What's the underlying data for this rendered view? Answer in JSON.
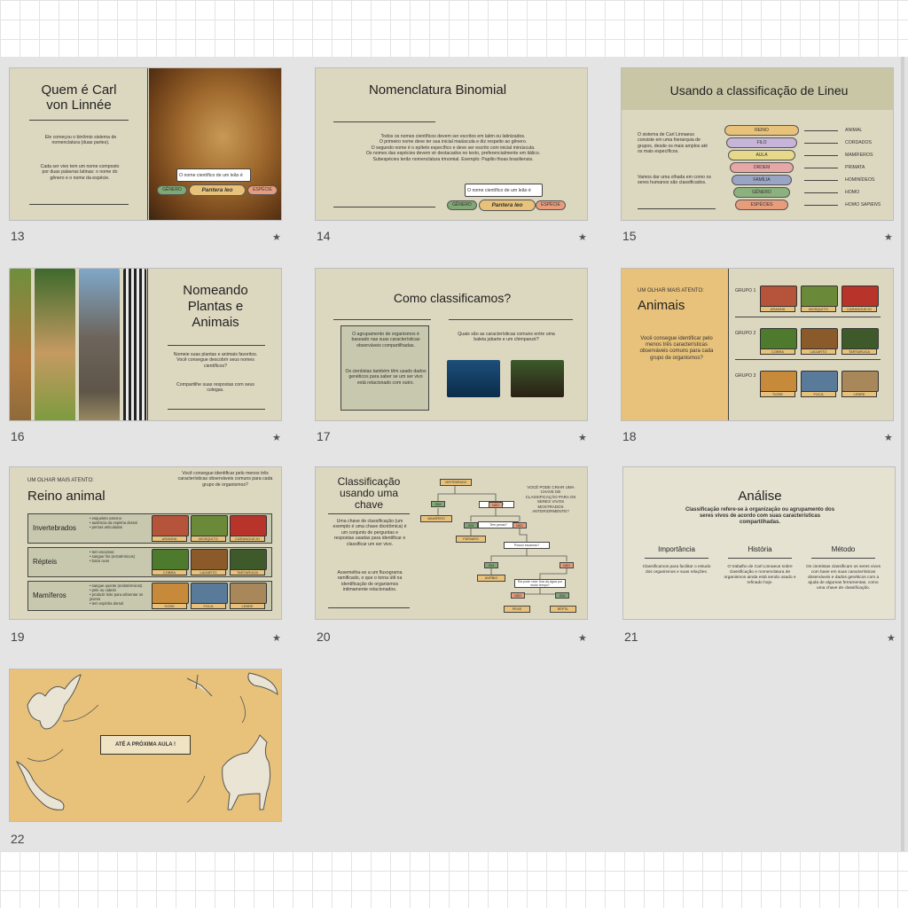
{
  "slides": [
    {
      "number": "13",
      "title": "Quem é Carl von Linnée",
      "body": "Ele começou o binômio sistema de nomenclatura (duas partes).",
      "body2": "Cada ser vivo tem um nome composto por duas palavras latinas: o nome do gênero e o nome da espécie.",
      "callout": "O nome científico de um leão é",
      "genus": "GÊNERO",
      "species_name": "Pantera leo",
      "species": "ESPÉCIE"
    },
    {
      "number": "14",
      "title": "Nomenclatura Binomial",
      "bullets": [
        "Todos os nomes científicos devem ser escritos em latim ou latinizados.",
        "O primeiro nome deve ter sua inicial maiúscula e diz respeito ao gênero.",
        "O segundo nome é o epíteto específico e deve ser escrito com inicial minúscula.",
        "Os nomes das espécies devem vir destacados no texto, preferencialmente em itálico.",
        "Subespécies terão nomenclatura trinomial. Exemplo: Papilio thoas brasiliensis."
      ],
      "callout": "O nome científico de um leão é",
      "genus": "GÊNERO",
      "species_name": "Pantera leo",
      "species": "ESPÉCIE"
    },
    {
      "number": "15",
      "title": "Usando a classificação de Lineu",
      "body": "O sistema de Carl Linnaeus consiste em uma hierarquia de grupos, desde os mais amplos até os mais específicos.",
      "body2": "Vamos dar uma olhada em como os seres humanos são classificados.",
      "ranks": [
        "REINO",
        "FILO",
        "AULA",
        "ORDEM",
        "FAMÍLIA",
        "GÊNERO",
        "ESPÉCIES"
      ],
      "values": [
        "ANIMAL",
        "CORDADOS",
        "MAMÍFEROS",
        "PRIMATA",
        "HOMINÍDEOS",
        "HOMO",
        "HOMO SAPIENS"
      ]
    },
    {
      "number": "16",
      "title": "Nomeando Plantas e Animais",
      "body": "Nomeie suas plantas e animais favoritos. Você consegue descobrir seus nomes científicos?",
      "body2": "Compartilhe suas respostas com seus colegas."
    },
    {
      "number": "17",
      "title": "Como classificamos?",
      "body": "O agrupamento de organismos é baseado nas suas características observáveis compartilhadas.",
      "body2": "Os cientistas também têm usado dados genéticos para saber se um ser vivo está relacionado com outro.",
      "question": "Quais são as características comuns entre uma baleia jubarte e um chimpanzé?"
    },
    {
      "number": "18",
      "kicker": "UM OLHAR MAIS ATENTO:",
      "title": "Animais",
      "body": "Você consegue identificar pelo menos três características observáveis comuns para cada grupo de organismos?",
      "groups": [
        {
          "label": "GRUPO 1",
          "items": [
            "ARANHA",
            "MOSQUITO",
            "CARANGUEJO"
          ]
        },
        {
          "label": "GRUPO 2",
          "items": [
            "COBRA",
            "LAGARTO",
            "TARTARUGA"
          ]
        },
        {
          "label": "GRUPO 3",
          "items": [
            "TIGRE",
            "FOCA",
            "LEBRE"
          ]
        }
      ]
    },
    {
      "number": "19",
      "kicker": "UM OLHAR MAIS ATENTO:",
      "title": "Reino animal",
      "question": "Você consegue identificar pelo menos três características observáveis comuns para cada grupo de organismos?",
      "rows": [
        {
          "label": "Invertebrados",
          "points": "• esqueleto externo\n• ausência da espinha dorsal\n• pernas articuladas",
          "items": [
            "ARANHA",
            "MOSQUITO",
            "CARANGUEJO"
          ]
        },
        {
          "label": "Répteis",
          "points": "• tem escamas\n• sangue frio (ectotérmicos)\n• botar ovos",
          "items": [
            "COBRA",
            "LAGARTO",
            "TARTARUGA"
          ]
        },
        {
          "label": "Mamíferos",
          "points": "• sangue quente (endotérmicos)\n• pele ou cabelo\n• produzir leite para alimentar os jovens\n• tem espinha dorsal",
          "items": [
            "TIGRE",
            "FOCA",
            "LEBRE"
          ]
        }
      ]
    },
    {
      "number": "20",
      "title": "Classificação usando uma chave",
      "body": "Uma chave de classificação (um exemplo é uma chave dicotômica) é um conjunto de perguntas e respostas usadas para identificar e classificar um ser vivo.",
      "body2": "Assemelha-se a um fluxograma ramificado, o que o torna útil na identificação de organismos intimamente relacionados.",
      "note": "VOCÊ PODE CRIAR UMA CHAVE DE CLASSIFICAÇÃO PARA OS SERES VIVOS MOSTRADOS ANTERIORMENTE?",
      "nodes": {
        "root": "VERTEBRADO",
        "q1": "Tem pelo?",
        "sim1": "SIM",
        "nao1": "NÃO",
        "mamifero": "MAMÍFERO",
        "q2": "Tem penas?",
        "sim2": "SIM",
        "nao2": "NÃO",
        "passaro": "PÁSSARO",
        "q3": "Possui escamas?",
        "sim3": "SIM",
        "nao3": "NÃO",
        "anfibio": "ANFÍBIO",
        "q4": "Ela pode viver fora da água por muito tempo?",
        "nao4": "NÃO",
        "sim4": "SIM",
        "peixe": "PEIXE",
        "reptil": "RÉPTIL"
      }
    },
    {
      "number": "21",
      "title": "Análise",
      "subtitle": "Classificação refere-se à organização ou agrupamento dos seres vivos de acordo com suas características compartilhadas.",
      "cols": [
        {
          "head": "Importância",
          "text": "Classificamos para facilitar o estudo dos organismos e suas relações."
        },
        {
          "head": "História",
          "text": "O trabalho de Carl Linnaeus sobre classificação e nomenclatura de organismos ainda está sendo usado e refinado hoje."
        },
        {
          "head": "Método",
          "text": "Os cientistas classificam os seres vivos com base em suas características observáveis e dados genéticos com a ajuda de algumas ferramentas, como uma chave de classificação."
        }
      ]
    },
    {
      "number": "22",
      "title": "ATÉ A PRÓXIMA AULA !"
    }
  ],
  "colors": {
    "slide_bg": "#dcd7bf",
    "accent_yellow": "#e8c27a",
    "sorter_bg": "#e4e4e4"
  }
}
